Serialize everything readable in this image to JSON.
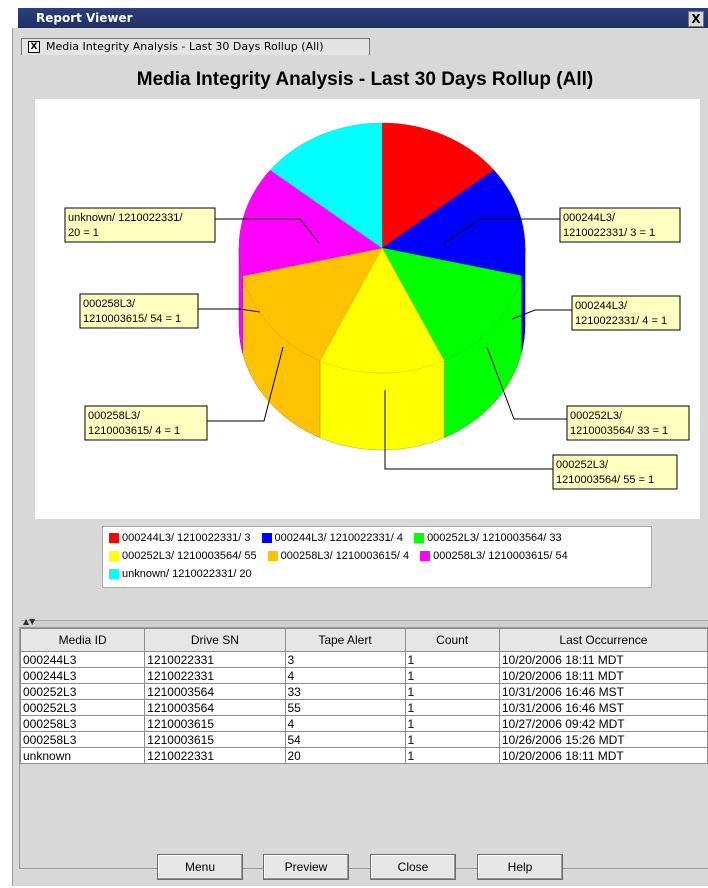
{
  "window": {
    "title": "Report Viewer",
    "close_glyph": "X"
  },
  "tab": {
    "label": "Media Integrity Analysis - Last 30 Days Rollup (All)",
    "close_glyph": "X"
  },
  "chart_data": {
    "type": "pie",
    "title": "Media Integrity Analysis - Last 30 Days Rollup (All)",
    "slices": [
      {
        "label": "000244L3/ 1210022331/ 3",
        "value": 1,
        "color": "#ff0000",
        "callout": [
          "000244L3/",
          "1210022331/ 3 = 1"
        ]
      },
      {
        "label": "000244L3/ 1210022331/ 4",
        "value": 1,
        "color": "#0000ff",
        "callout": [
          "000244L3/",
          "1210022331/ 4 = 1"
        ]
      },
      {
        "label": "000252L3/ 1210003564/ 33",
        "value": 1,
        "color": "#00ff00",
        "callout": [
          "000252L3/",
          "1210003564/ 33 = 1"
        ]
      },
      {
        "label": "000252L3/ 1210003564/ 55",
        "value": 1,
        "color": "#ffff00",
        "callout": [
          "000252L3/",
          "1210003564/ 55 = 1"
        ]
      },
      {
        "label": "000258L3/ 1210003615/ 4",
        "value": 1,
        "color": "#ffc200",
        "callout": [
          "000258L3/",
          "1210003615/ 4 = 1"
        ]
      },
      {
        "label": "000258L3/ 1210003615/ 54",
        "value": 1,
        "color": "#ff00ff",
        "callout": [
          "000258L3/",
          "1210003615/ 54 = 1"
        ]
      },
      {
        "label": "unknown/ 1210022331/ 20",
        "value": 1,
        "color": "#00ffff",
        "callout": [
          "unknown/ 1210022331/",
          "20 = 1"
        ]
      }
    ]
  },
  "table": {
    "columns": [
      "Media ID",
      "Drive SN",
      "Tape Alert",
      "Count",
      "Last Occurrence"
    ],
    "rows": [
      [
        "000244L3",
        "1210022331",
        "3",
        "1",
        "10/20/2006 18:11 MDT"
      ],
      [
        "000244L3",
        "1210022331",
        "4",
        "1",
        "10/20/2006 18:11 MDT"
      ],
      [
        "000252L3",
        "1210003564",
        "33",
        "1",
        "10/31/2006 16:46 MST"
      ],
      [
        "000252L3",
        "1210003564",
        "55",
        "1",
        "10/31/2006 16:46 MST"
      ],
      [
        "000258L3",
        "1210003615",
        "4",
        "1",
        "10/27/2006 09:42 MDT"
      ],
      [
        "000258L3",
        "1210003615",
        "54",
        "1",
        "10/26/2006 15:26 MDT"
      ],
      [
        "unknown",
        "1210022331",
        "20",
        "1",
        "10/20/2006 18:11 MDT"
      ]
    ]
  },
  "buttons": {
    "menu": "Menu",
    "preview": "Preview",
    "close": "Close",
    "help": "Help"
  }
}
